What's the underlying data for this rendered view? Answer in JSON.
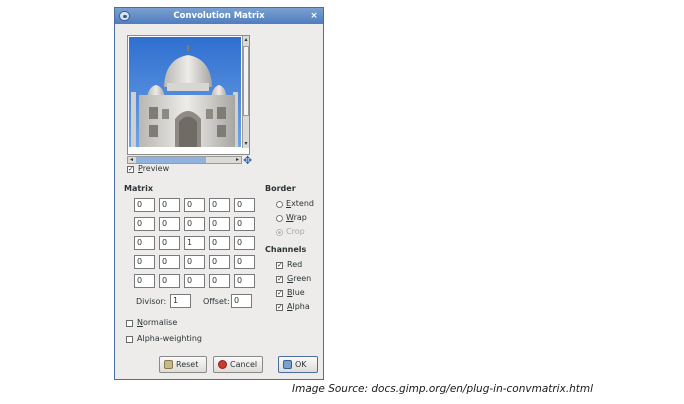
{
  "window": {
    "title": "Convolution Matrix"
  },
  "preview": {
    "label": "Preview",
    "checked": true
  },
  "matrix": {
    "heading": "Matrix",
    "rows": [
      [
        "0",
        "0",
        "0",
        "0",
        "0"
      ],
      [
        "0",
        "0",
        "0",
        "0",
        "0"
      ],
      [
        "0",
        "0",
        "1",
        "0",
        "0"
      ],
      [
        "0",
        "0",
        "0",
        "0",
        "0"
      ],
      [
        "0",
        "0",
        "0",
        "0",
        "0"
      ]
    ],
    "divisor_label": "Divisor:",
    "divisor_value": "1",
    "offset_label": "Offset:",
    "offset_value": "0"
  },
  "border": {
    "heading": "Border",
    "options": [
      {
        "label": "Extend",
        "selected": false,
        "enabled": true
      },
      {
        "label": "Wrap",
        "selected": false,
        "enabled": true
      },
      {
        "label": "Crop",
        "selected": true,
        "enabled": false
      }
    ]
  },
  "channels": {
    "heading": "Channels",
    "items": [
      {
        "label": "Red",
        "checked": true
      },
      {
        "label": "Green",
        "checked": true
      },
      {
        "label": "Blue",
        "checked": true
      },
      {
        "label": "Alpha",
        "checked": true
      }
    ]
  },
  "options": {
    "normalise": {
      "label": "Normalise",
      "checked": false
    },
    "alpha_weighting": {
      "label": "Alpha-weighting",
      "checked": false
    }
  },
  "buttons": {
    "reset": "Reset",
    "cancel": "Cancel",
    "ok": "OK"
  },
  "caption": "Image Source: docs.gimp.org/en/plug-in-convmatrix.html"
}
